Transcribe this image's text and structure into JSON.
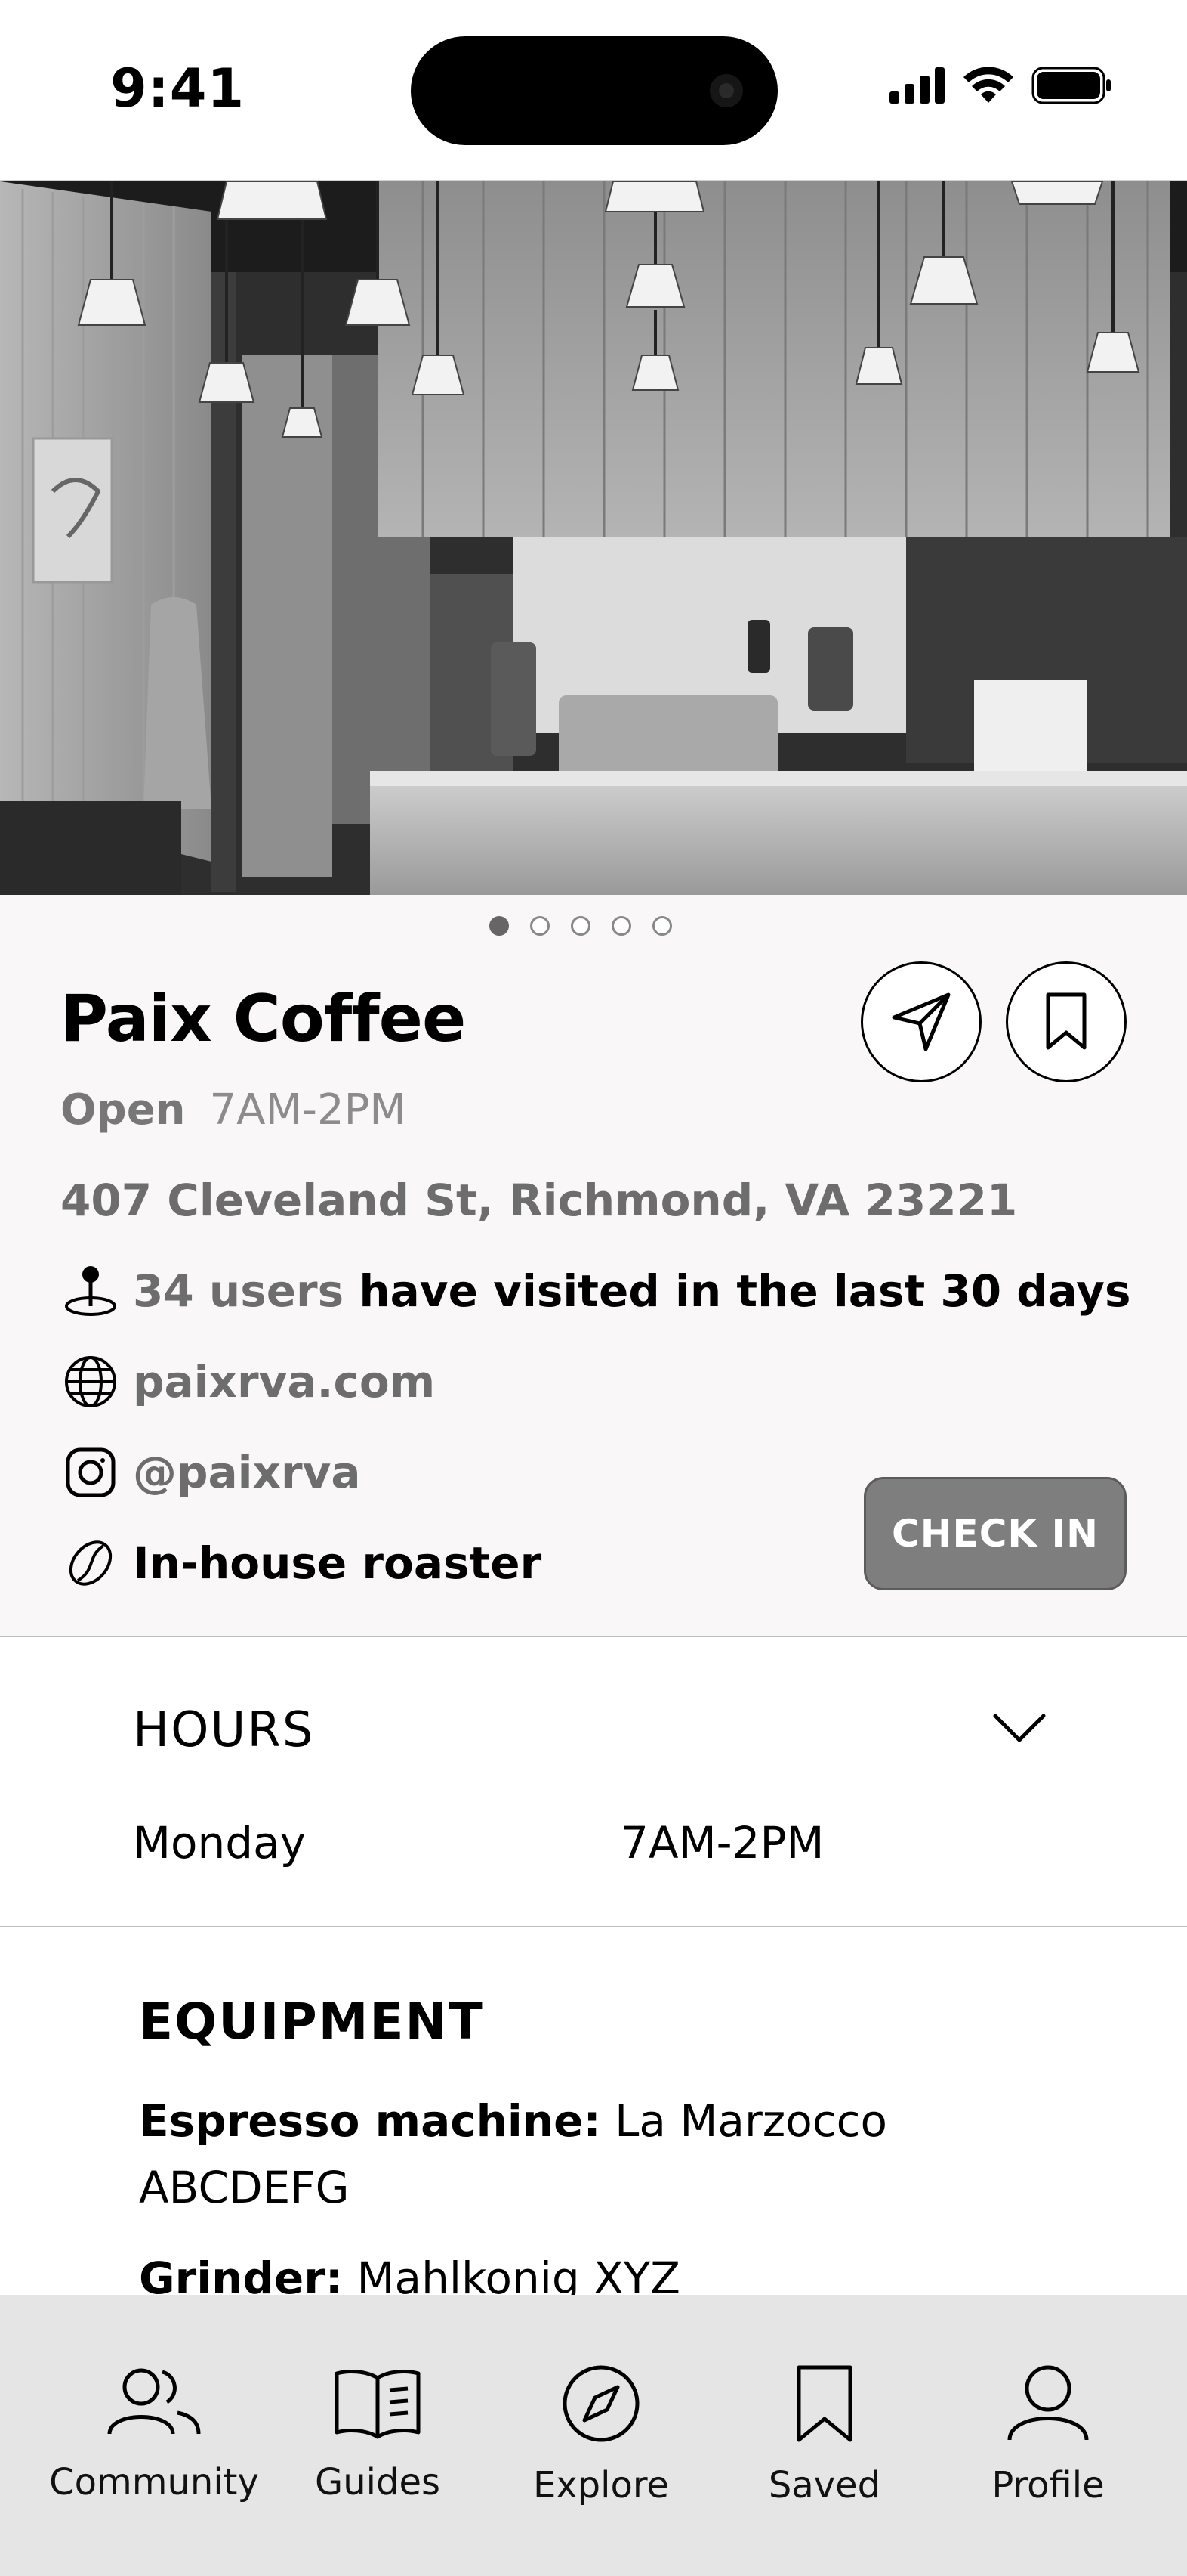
{
  "status_bar": {
    "time": "9:41"
  },
  "hero": {
    "slide_count": 5,
    "active_slide": 1
  },
  "place": {
    "name": "Paix Coffee",
    "open_label": "Open",
    "open_hours": "7AM-2PM",
    "address": "407 Cleveland St, Richmond, VA 23221",
    "visits_count": "34 users",
    "visits_text": " have visited in the last 30 days",
    "website": "paixrva.com",
    "instagram": "@paixrva",
    "roaster": "In-house roaster",
    "checkin_label": "CHECK IN"
  },
  "hours": {
    "title": "HOURS",
    "day": "Monday",
    "day_hours": "7AM-2PM"
  },
  "equipment": {
    "title": "EQUIPMENT",
    "items": [
      {
        "label": "Espresso machine:",
        "value": " La Marzocco ABCDEFG"
      },
      {
        "label": "Grinder:",
        "value": " Mahlkonig XYZ"
      }
    ]
  },
  "tabbar": {
    "items": [
      {
        "label": "Community",
        "icon": "community-icon"
      },
      {
        "label": "Guides",
        "icon": "book-icon"
      },
      {
        "label": "Explore",
        "icon": "compass-icon"
      },
      {
        "label": "Saved",
        "icon": "bookmark-icon"
      },
      {
        "label": "Profile",
        "icon": "person-icon"
      }
    ]
  },
  "colors": {
    "button_gray": "#7e7e7e",
    "panel_bg": "#f9f7f8",
    "tabbar_bg": "#e5e5e5"
  }
}
